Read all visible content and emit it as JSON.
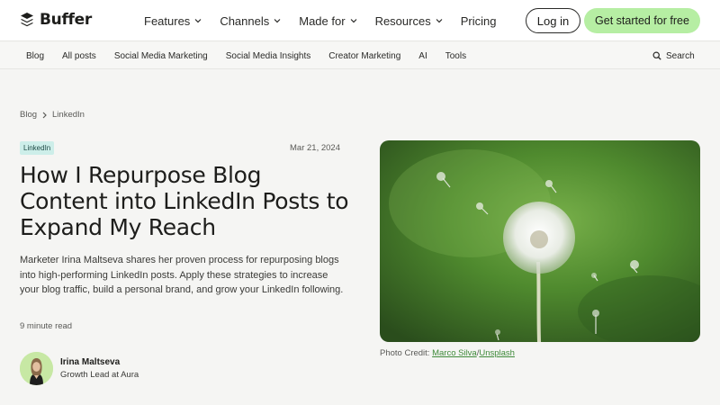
{
  "brand": {
    "name": "Buffer"
  },
  "nav": {
    "items": [
      "Features",
      "Channels",
      "Made for",
      "Resources",
      "Pricing"
    ],
    "login_label": "Log in",
    "cta_label": "Get started for free"
  },
  "subnav": {
    "items": [
      "Blog",
      "All posts",
      "Social Media Marketing",
      "Social Media Insights",
      "Creator Marketing",
      "AI",
      "Tools"
    ],
    "search_label": "Search"
  },
  "breadcrumb": [
    "Blog",
    "LinkedIn"
  ],
  "article": {
    "tag": "LinkedIn",
    "date": "Mar 21, 2024",
    "title": "How I Repurpose Blog Content into LinkedIn Posts to Expand My Reach",
    "summary": "Marketer Irina Maltseva shares her proven process for repurposing blogs into high-performing LinkedIn posts. Apply these strategies to increase your blog traffic, build a personal brand, and grow your LinkedIn following.",
    "read_time": "9 minute read",
    "author": {
      "name": "Irina Maltseva",
      "role": "Growth Lead at Aura"
    },
    "image_credit": {
      "prefix": "Photo Credit: ",
      "photographer": "Marco Silva",
      "separator": "/",
      "source": "Unsplash"
    }
  },
  "colors": {
    "cta": "#b6eea3",
    "tag_bg": "#cdeee9",
    "link": "#3f8a3a",
    "page_bg": "#f5f5f3"
  },
  "icons": [
    "buffer-logo-icon",
    "chevron-down-icon",
    "chevron-right-icon",
    "search-icon"
  ]
}
